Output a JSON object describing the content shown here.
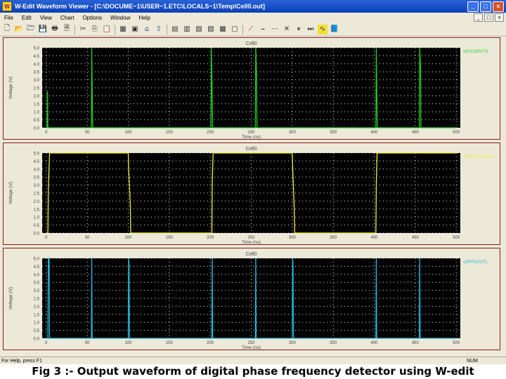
{
  "window": {
    "icon_label": "W",
    "title": "W-Edit Waveform Viewer - [C:\\DOCUME~1\\USER~1.ETC\\LOCALS~1\\Temp\\Cell0.out]",
    "min_label": "_",
    "max_label": "□",
    "close_label": "×"
  },
  "menu": {
    "items": [
      "File",
      "Edit",
      "View",
      "Chart",
      "Options",
      "Window",
      "Help"
    ],
    "doc_min": "_",
    "doc_max": "□",
    "doc_close": "×"
  },
  "toolbar": {
    "groups": [
      [
        "new-icon",
        "open-icon",
        "open-folder-icon",
        "save-icon",
        "print-icon",
        "print-preview-icon"
      ],
      [
        "cut-icon",
        "copy-icon",
        "paste-icon"
      ],
      [
        "grid-icon",
        "zoom-icon",
        "home-icon",
        "export-icon"
      ],
      [
        "chart-a-icon",
        "chart-b-icon",
        "chart-c-icon",
        "chart-d-icon",
        "chart-e-icon",
        "chart-f-icon"
      ],
      [
        "line-red-icon",
        "line-flat-icon",
        "line-dots-icon",
        "line-x-icon",
        "pause-icon",
        "step-icon",
        "waveform-icon",
        "book-icon"
      ]
    ],
    "glyphs": {
      "new-icon": "🗋",
      "open-icon": "📂",
      "open-folder-icon": "🗁",
      "save-icon": "💾",
      "print-icon": "🖶",
      "print-preview-icon": "🗎",
      "cut-icon": "✂",
      "copy-icon": "⎘",
      "paste-icon": "📋",
      "grid-icon": "▦",
      "zoom-icon": "▣",
      "home-icon": "⌂",
      "export-icon": "⇪",
      "chart-a-icon": "▤",
      "chart-b-icon": "▥",
      "chart-c-icon": "▧",
      "chart-d-icon": "▨",
      "chart-e-icon": "▩",
      "chart-f-icon": "▢",
      "line-red-icon": "⟋",
      "line-flat-icon": "⎯",
      "line-dots-icon": "⋯",
      "line-x-icon": "✕",
      "pause-icon": "⏸",
      "step-icon": "⏭",
      "waveform-icon": "∿",
      "book-icon": "📘"
    }
  },
  "chart_data": [
    {
      "type": "line",
      "title": "Cell0",
      "xlabel": "Time (ns)",
      "ylabel": "Voltage (V)",
      "xlim": [
        -5,
        505
      ],
      "ylim": [
        0,
        5
      ],
      "x_ticks": [
        0,
        50,
        100,
        150,
        200,
        250,
        300,
        350,
        400,
        450,
        500
      ],
      "y_ticks": [
        0,
        0.5,
        1,
        1.5,
        2,
        2.5,
        3,
        3.5,
        4,
        4.5,
        5
      ],
      "grid": true,
      "legend_position": "top-right",
      "series": [
        {
          "name": "v(VCOOUT)",
          "color": "#22cc22",
          "points": [
            [
              0,
              0
            ],
            [
              1,
              0
            ],
            [
              1.5,
              2.3
            ],
            [
              2,
              0
            ],
            [
              55,
              0
            ],
            [
              55.5,
              5
            ],
            [
              56.5,
              0.3
            ],
            [
              57,
              0
            ],
            [
              201,
              0
            ],
            [
              201.5,
              5
            ],
            [
              202.5,
              1.6
            ],
            [
              203,
              0
            ],
            [
              255,
              0
            ],
            [
              255.5,
              5
            ],
            [
              256.5,
              3.2
            ],
            [
              257,
              0
            ],
            [
              402,
              0
            ],
            [
              402.5,
              5
            ],
            [
              403.5,
              0.8
            ],
            [
              404,
              0
            ],
            [
              455,
              0
            ],
            [
              455.5,
              5
            ],
            [
              456.5,
              3.8
            ],
            [
              457,
              0
            ],
            [
              500,
              0
            ]
          ]
        }
      ]
    },
    {
      "type": "line",
      "title": "Cell0",
      "xlabel": "Time (ns)",
      "ylabel": "Voltage (V)",
      "xlim": [
        -5,
        505
      ],
      "ylim": [
        0,
        5
      ],
      "x_ticks": [
        0,
        50,
        100,
        150,
        200,
        250,
        300,
        350,
        400,
        450,
        500
      ],
      "y_ticks": [
        0,
        0.5,
        1,
        1.5,
        2,
        2.5,
        3,
        3.5,
        4,
        4.5,
        5
      ],
      "grid": true,
      "legend_position": "top-right",
      "series": [
        {
          "name": "v(REFSIGNAL)",
          "color": "#eeee44",
          "points": [
            [
              0,
              0
            ],
            [
              2,
              0
            ],
            [
              2.5,
              2.7
            ],
            [
              3.5,
              4.2
            ],
            [
              4,
              5
            ],
            [
              100,
              5
            ],
            [
              100.5,
              4
            ],
            [
              102.5,
              1.8
            ],
            [
              103,
              0
            ],
            [
              202,
              0
            ],
            [
              202.5,
              3.3
            ],
            [
              203.5,
              5
            ],
            [
              300,
              5
            ],
            [
              300.5,
              4.1
            ],
            [
              302.5,
              1.5
            ],
            [
              303,
              0
            ],
            [
              402,
              0
            ],
            [
              402.5,
              3
            ],
            [
              403.5,
              5
            ],
            [
              500,
              5
            ]
          ]
        }
      ]
    },
    {
      "type": "line",
      "title": "Cell0",
      "xlabel": "Time (ns)",
      "ylabel": "Voltage (V)",
      "xlim": [
        -5,
        505
      ],
      "ylim": [
        0,
        5
      ],
      "x_ticks": [
        0,
        50,
        100,
        150,
        200,
        250,
        300,
        350,
        400,
        450,
        500
      ],
      "y_ticks": [
        0,
        0.5,
        1,
        1.5,
        2,
        2.5,
        3,
        3.5,
        4,
        4.5,
        5
      ],
      "grid": true,
      "legend_position": "top-right",
      "series": [
        {
          "name": "v(PFDOUT)",
          "color": "#22b8d8",
          "points": [
            [
              0,
              0
            ],
            [
              2,
              0
            ],
            [
              2.5,
              5
            ],
            [
              3.5,
              5
            ],
            [
              4,
              0
            ],
            [
              55,
              0
            ],
            [
              55.5,
              5
            ],
            [
              56,
              0
            ],
            [
              100,
              0
            ],
            [
              100.5,
              5
            ],
            [
              101,
              4.6
            ],
            [
              101.5,
              0
            ],
            [
              202,
              0
            ],
            [
              202.5,
              5
            ],
            [
              203,
              0
            ],
            [
              255,
              0
            ],
            [
              255.5,
              5
            ],
            [
              256,
              0
            ],
            [
              300,
              0
            ],
            [
              300.5,
              5
            ],
            [
              301,
              4.5
            ],
            [
              301.5,
              0.3
            ],
            [
              302,
              0
            ],
            [
              402,
              0
            ],
            [
              402.5,
              5
            ],
            [
              403,
              0
            ],
            [
              455,
              0
            ],
            [
              455.5,
              5
            ],
            [
              456,
              0
            ],
            [
              500,
              0
            ]
          ]
        }
      ]
    }
  ],
  "status": {
    "left": "For Help, press F1",
    "right": "NUM"
  },
  "caption": "Fig 3 :- Output waveform of digital phase frequency detector using W-edit",
  "colors": {
    "plot_background": "#000000",
    "grid": "#e8e8e8",
    "panel_border": "#8b1a1a",
    "axis_text": "#444444"
  }
}
